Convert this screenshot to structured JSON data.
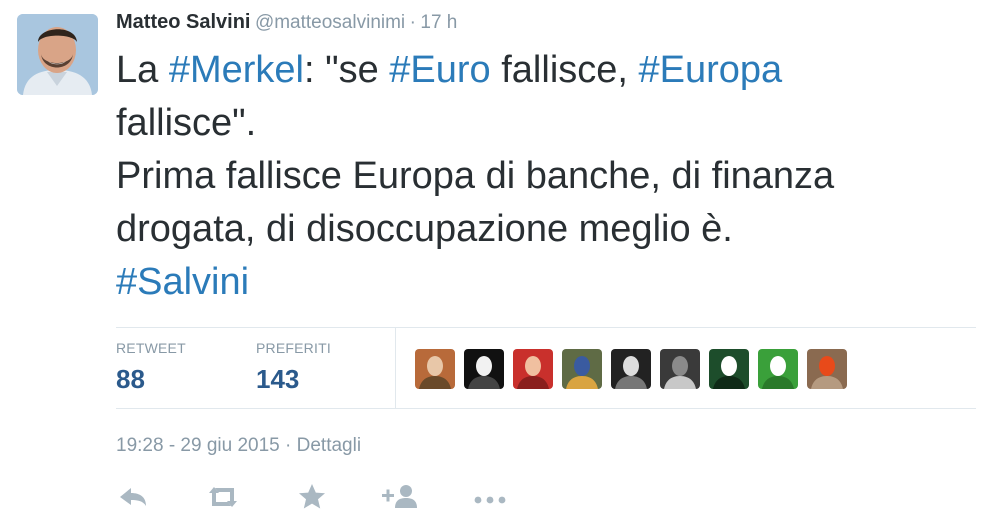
{
  "tweet": {
    "author_name": "Matteo Salvini",
    "handle": "@matteosalvinimi",
    "separator": "·",
    "age": "17 h",
    "lines": [
      [
        {
          "text": "La "
        },
        {
          "text": "#Merkel",
          "tag": true
        },
        {
          "text": ": \"se "
        },
        {
          "text": "#Euro",
          "tag": true
        },
        {
          "text": " fallisce, "
        },
        {
          "text": "#Europa",
          "tag": true
        }
      ],
      [
        {
          "text": "fallisce\"."
        }
      ],
      [
        {
          "text": "Prima fallisce Europa di banche, di finanza"
        }
      ],
      [
        {
          "text": "drogata, di disoccupazione meglio è."
        }
      ],
      [
        {
          "text": "#Salvini",
          "tag": true
        }
      ]
    ]
  },
  "stats": {
    "retweet_label": "RETWEET",
    "retweet_count": "88",
    "favorites_label": "PREFERITI",
    "favorites_count": "143"
  },
  "favoriters": [
    {
      "name": "favoriter-avatar-1",
      "colors": [
        "#b86a3a",
        "#e8c7a8",
        "#6a4a2a"
      ]
    },
    {
      "name": "favoriter-avatar-2",
      "colors": [
        "#111111",
        "#f2f2f2",
        "#444444"
      ]
    },
    {
      "name": "favoriter-avatar-3",
      "colors": [
        "#c9302c",
        "#f0c0a0",
        "#8a1f1d"
      ]
    },
    {
      "name": "favoriter-avatar-4",
      "colors": [
        "#5f6b45",
        "#3a5ba0",
        "#d9a441"
      ]
    },
    {
      "name": "favoriter-avatar-5",
      "colors": [
        "#222222",
        "#dddddd",
        "#777777"
      ]
    },
    {
      "name": "favoriter-avatar-6",
      "colors": [
        "#3a3a3a",
        "#8a8a8a",
        "#c8c8c8"
      ]
    },
    {
      "name": "favoriter-avatar-7",
      "colors": [
        "#1d4d2b",
        "#ffffff",
        "#0f2a17"
      ]
    },
    {
      "name": "favoriter-avatar-8",
      "colors": [
        "#3aa03a",
        "#ffffff",
        "#2a7a2a"
      ]
    },
    {
      "name": "favoriter-avatar-9",
      "colors": [
        "#8a6a50",
        "#e84a1a",
        "#b59a80"
      ]
    }
  ],
  "meta": {
    "timestamp": "19:28 - 29 giu 2015",
    "separator": "·",
    "details_label": "Dettagli"
  },
  "actions": [
    "reply-icon",
    "retweet-icon",
    "favorite-icon",
    "follow-icon",
    "more-icon"
  ],
  "colors": {
    "hashtag": "#2b7bb9",
    "count": "#2b5a8c",
    "muted": "#8899a6",
    "text": "#292f33",
    "action_icon": "#aab8c2"
  }
}
